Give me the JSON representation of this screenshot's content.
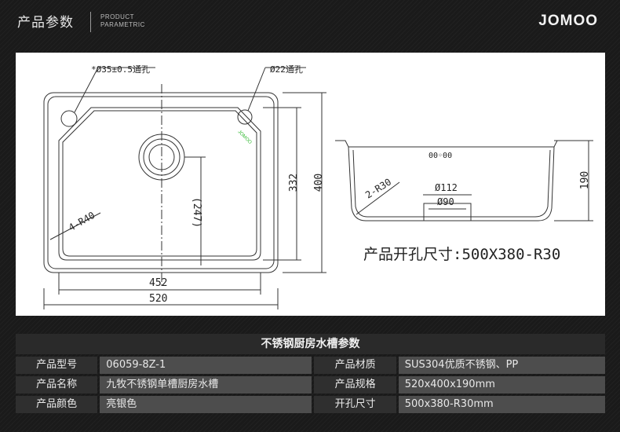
{
  "header": {
    "title": "产品参数",
    "subtitle_line1": "PRODUCT",
    "subtitle_line2": "PARAMETRIC",
    "logo": "JOMOO"
  },
  "drawing": {
    "hole35": "*Ø35±0.5通孔",
    "hole22": "Ø22通孔",
    "radius_left": "4-R40",
    "dim_247": "(247)",
    "dim_332": "332",
    "dim_400": "400",
    "dim_452": "452",
    "dim_520": "520",
    "side_radius": "2-R30",
    "dim_112": "Ø112",
    "dim_90": "Ø90",
    "dim_190": "190",
    "mark": "00◦00",
    "cutout": "产品开孔尺寸:500X380-R30",
    "logo_small": "JOMOO"
  },
  "table": {
    "title": "不锈钢厨房水槽参数",
    "rows": [
      {
        "label1": "产品型号",
        "value1": "06059-8Z-1",
        "label2": "产品材质",
        "value2": "SUS304优质不锈钢、PP"
      },
      {
        "label1": "产品名称",
        "value1": "九牧不锈钢单槽厨房水槽",
        "label2": "产品规格",
        "value2": "520x400x190mm"
      },
      {
        "label1": "产品颜色",
        "value1": "亮银色",
        "label2": "开孔尺寸",
        "value2": "500x380-R30mm"
      }
    ]
  },
  "colors": {
    "background": "#1a1a1a",
    "drawing_bg": "#ffffff",
    "label_cell": "#2f2f2f",
    "value_cell": "#4d4d4d",
    "accent_green": "#2db82d"
  }
}
